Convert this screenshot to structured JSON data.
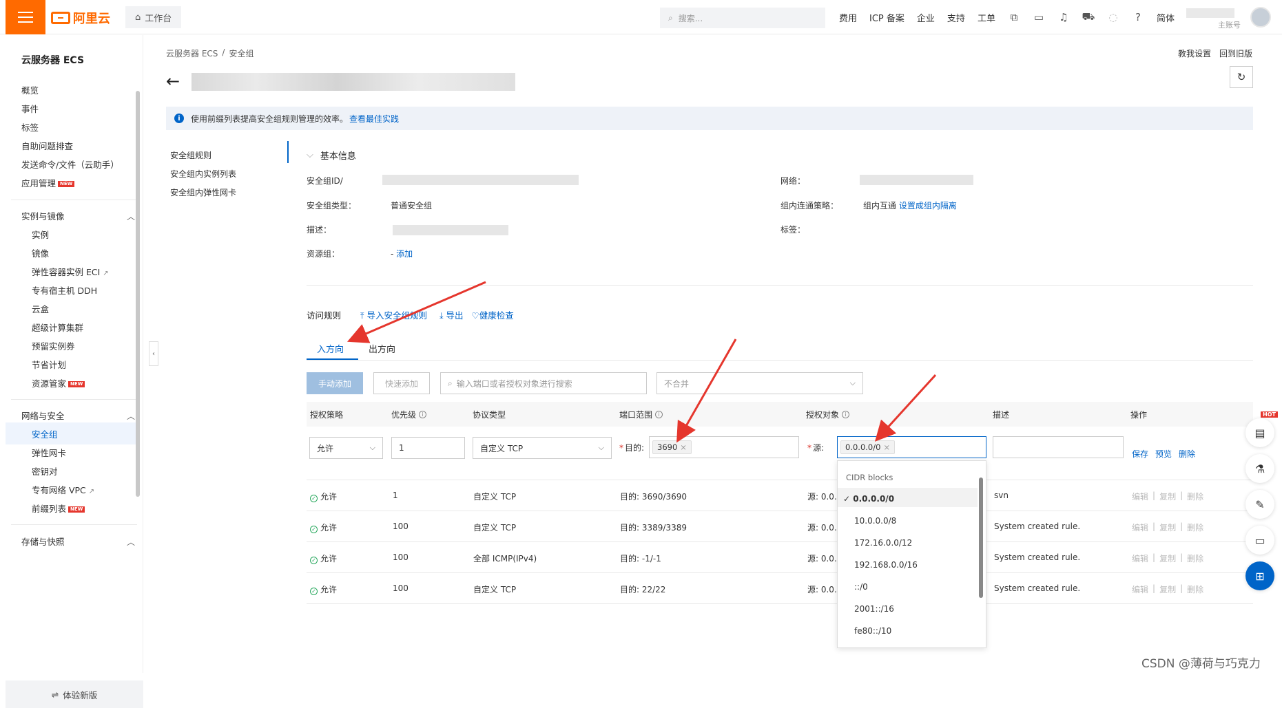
{
  "topbar": {
    "logo": "阿里云",
    "workbench": "工作台",
    "search_placeholder": "搜索...",
    "nav": [
      "费用",
      "ICP 备案",
      "企业",
      "支持",
      "工单"
    ],
    "lang": "简体",
    "account_sub": "主账号"
  },
  "sidebar": {
    "title": "云服务器 ECS",
    "items_top": [
      "概览",
      "事件",
      "标签",
      "自助问题排查",
      "发送命令/文件（云助手）",
      "应用管理"
    ],
    "group1": "实例与镜像",
    "group1_items": [
      "实例",
      "镜像",
      "弹性容器实例 ECI",
      "专有宿主机 DDH",
      "云盒",
      "超级计算集群",
      "预留实例券",
      "节省计划",
      "资源管家"
    ],
    "group2": "网络与安全",
    "group2_items": [
      "安全组",
      "弹性网卡",
      "密钥对",
      "专有网络 VPC",
      "前缀列表"
    ],
    "group3": "存储与快照",
    "footer": "体验新版",
    "new_badge": "NEW"
  },
  "breadcrumb": [
    "云服务器 ECS",
    "/",
    "安全组"
  ],
  "top_links": [
    "教我设置",
    "回到旧版"
  ],
  "banner": {
    "text": "使用前缀列表提高安全组规则管理的效率。",
    "link": "查看最佳实践"
  },
  "subnav": [
    "安全组规则",
    "安全组内实例列表",
    "安全组内弹性网卡"
  ],
  "basic": {
    "title": "基本信息",
    "id_label": "安全组ID/",
    "network_label": "网络：",
    "type_label": "安全组类型：",
    "type_value": "普通安全组",
    "intra_label": "组内连通策略：",
    "intra_value": "组内互通",
    "intra_link": "设置成组内隔离",
    "desc_label": "描述：",
    "tags_label": "标签：",
    "rg_label": "资源组：",
    "rg_value": "-",
    "rg_link": "添加"
  },
  "rules": {
    "title": "访问规则",
    "import": "导入安全组规则",
    "export": "导出",
    "health": "健康检查",
    "tab_in": "入方向",
    "tab_out": "出方向",
    "manual_add": "手动添加",
    "quick_add": "快速添加",
    "search_placeholder": "输入端口或者授权对象进行搜索",
    "merge_placeholder": "不合并",
    "headers": [
      "授权策略",
      "优先级",
      "协议类型",
      "端口范围",
      "授权对象",
      "描述",
      "操作"
    ],
    "edit_row": {
      "policy": "允许",
      "priority": "1",
      "protocol": "自定义 TCP",
      "dest_label": "目的:",
      "port_tag": "3690",
      "src_label": "源:",
      "src_tag": "0.0.0.0/0",
      "ops": [
        "保存",
        "预览",
        "删除"
      ]
    },
    "rows": [
      {
        "policy": "允许",
        "priority": "1",
        "protocol": "自定义 TCP",
        "port": "目的: 3690/3690",
        "src": "源: 0.0.0",
        "desc": "svn"
      },
      {
        "policy": "允许",
        "priority": "100",
        "protocol": "自定义 TCP",
        "port": "目的: 3389/3389",
        "src": "源: 0.0.0",
        "desc": "System created rule."
      },
      {
        "policy": "允许",
        "priority": "100",
        "protocol": "全部 ICMP(IPv4)",
        "port": "目的: -1/-1",
        "src": "源: 0.0.0",
        "desc": "System created rule."
      },
      {
        "policy": "允许",
        "priority": "100",
        "protocol": "自定义 TCP",
        "port": "目的: 22/22",
        "src": "源: 0.0.0",
        "desc": "System created rule."
      }
    ],
    "row_ops": [
      "编辑",
      "复制",
      "删除"
    ]
  },
  "dropdown": {
    "header": "CIDR blocks",
    "options": [
      "0.0.0.0/0",
      "10.0.0.0/8",
      "172.16.0.0/12",
      "192.168.0.0/16",
      "::/0",
      "2001::/16",
      "fe80::/10"
    ],
    "selected": "0.0.0.0/0"
  },
  "float": {
    "hot": "HOT"
  },
  "watermark": "CSDN @薄荷与巧克力",
  "colors": {
    "brand": "#ff6a00",
    "link": "#0064c8",
    "annotation_arrow": "#e5362d",
    "success": "#27a85d"
  }
}
